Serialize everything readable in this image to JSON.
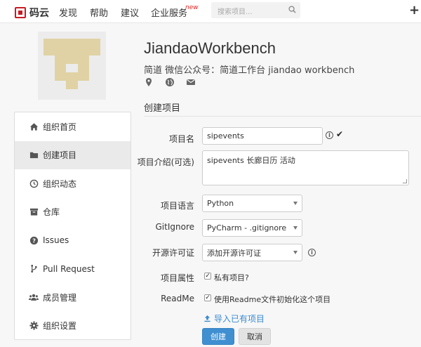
{
  "nav": {
    "logo_text": "码云",
    "items": [
      "发现",
      "帮助",
      "建议",
      "企业服务"
    ],
    "new_badge": "new",
    "search_placeholder": "搜索项目..."
  },
  "org": {
    "name": "JiandaoWorkbench",
    "description": "简道 微信公众号：简道工作台 jiandao workbench"
  },
  "section_title": "创建项目",
  "sidebar": {
    "items": [
      {
        "label": "组织首页",
        "icon": "home-icon",
        "active": false
      },
      {
        "label": "创建项目",
        "icon": "folder-icon",
        "active": true
      },
      {
        "label": "组织动态",
        "icon": "clock-icon",
        "active": false
      },
      {
        "label": "仓库",
        "icon": "archive-icon",
        "active": false
      },
      {
        "label": "Issues",
        "icon": "question-circle-icon",
        "active": false
      },
      {
        "label": "Pull Request",
        "icon": "branch-icon",
        "active": false
      },
      {
        "label": "成员管理",
        "icon": "users-icon",
        "active": false
      },
      {
        "label": "组织设置",
        "icon": "gear-icon",
        "active": false
      }
    ]
  },
  "form": {
    "name_label": "项目名",
    "name_value": "sipevents",
    "desc_label": "项目介绍(可选)",
    "desc_value": "sipevents 长廊日历 活动",
    "lang_label": "项目语言",
    "lang_value": "Python",
    "gitignore_label": "GitIgnore",
    "gitignore_value": "PyCharm - .gitignore",
    "license_label": "开源许可证",
    "license_value": "添加开源许可证",
    "attr_label": "项目属性",
    "private_label": "私有项目?",
    "private_checked": true,
    "readme_label": "ReadMe",
    "readme_text": "使用Readme文件初始化这个项目",
    "readme_checked": true,
    "import_link": "导入已有项目",
    "create_button": "创建",
    "cancel_button": "取消"
  },
  "colors": {
    "brand": "#c71d23",
    "primary": "#3f8fd1",
    "link": "#3a8bd0",
    "avatar_tan": "#e0d2a4"
  }
}
